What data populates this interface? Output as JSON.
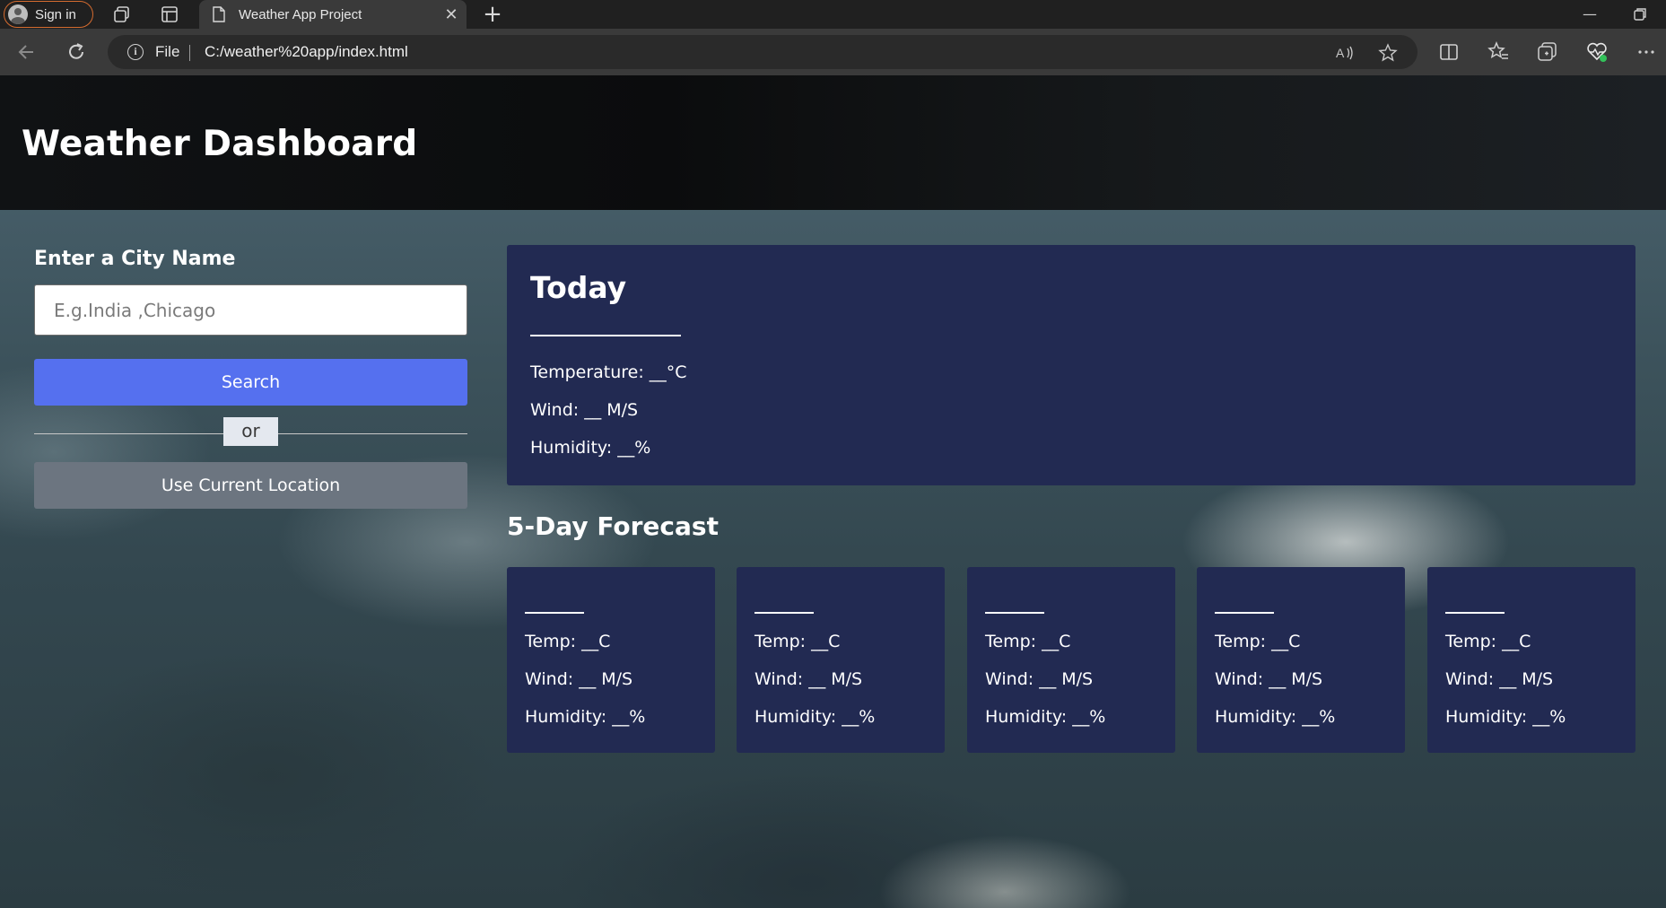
{
  "browser": {
    "signin_label": "Sign in",
    "tab_title": "Weather App Project",
    "address_scheme": "File",
    "address_url": "C:/weather%20app/index.html"
  },
  "page": {
    "title": "Weather Dashboard",
    "sidebar": {
      "label": "Enter a City Name",
      "input_placeholder": "E.g.India ,Chicago",
      "input_value": "",
      "search_label": "Search",
      "or_label": "or",
      "location_label": "Use Current Location"
    },
    "today": {
      "heading": "Today",
      "temperature": "Temperature: __°C",
      "wind": "Wind: __ M/S",
      "humidity": "Humidity: __%"
    },
    "forecast": {
      "heading": "5-Day Forecast",
      "days": [
        {
          "temp": "Temp: __C",
          "wind": "Wind: __ M/S",
          "humidity": "Humidity: __%"
        },
        {
          "temp": "Temp: __C",
          "wind": "Wind: __ M/S",
          "humidity": "Humidity: __%"
        },
        {
          "temp": "Temp: __C",
          "wind": "Wind: __ M/S",
          "humidity": "Humidity: __%"
        },
        {
          "temp": "Temp: __C",
          "wind": "Wind: __ M/S",
          "humidity": "Humidity: __%"
        },
        {
          "temp": "Temp: __C",
          "wind": "Wind: __ M/S",
          "humidity": "Humidity: __%"
        }
      ]
    }
  },
  "colors": {
    "header_bg": "#0b0c0d",
    "card_bg": "#222a52",
    "search_button": "#5570ef",
    "location_button": "#6c7580"
  },
  "icons": [
    "profile-icon",
    "workspaces-icon",
    "tab-actions-icon",
    "page-icon",
    "close-icon",
    "new-tab-icon",
    "minimize-icon",
    "restore-icon",
    "back-icon",
    "refresh-icon",
    "info-icon",
    "read-aloud-icon",
    "favorite-star-icon",
    "split-screen-icon",
    "favorites-icon",
    "collections-icon",
    "browser-essentials-icon",
    "more-icon"
  ]
}
